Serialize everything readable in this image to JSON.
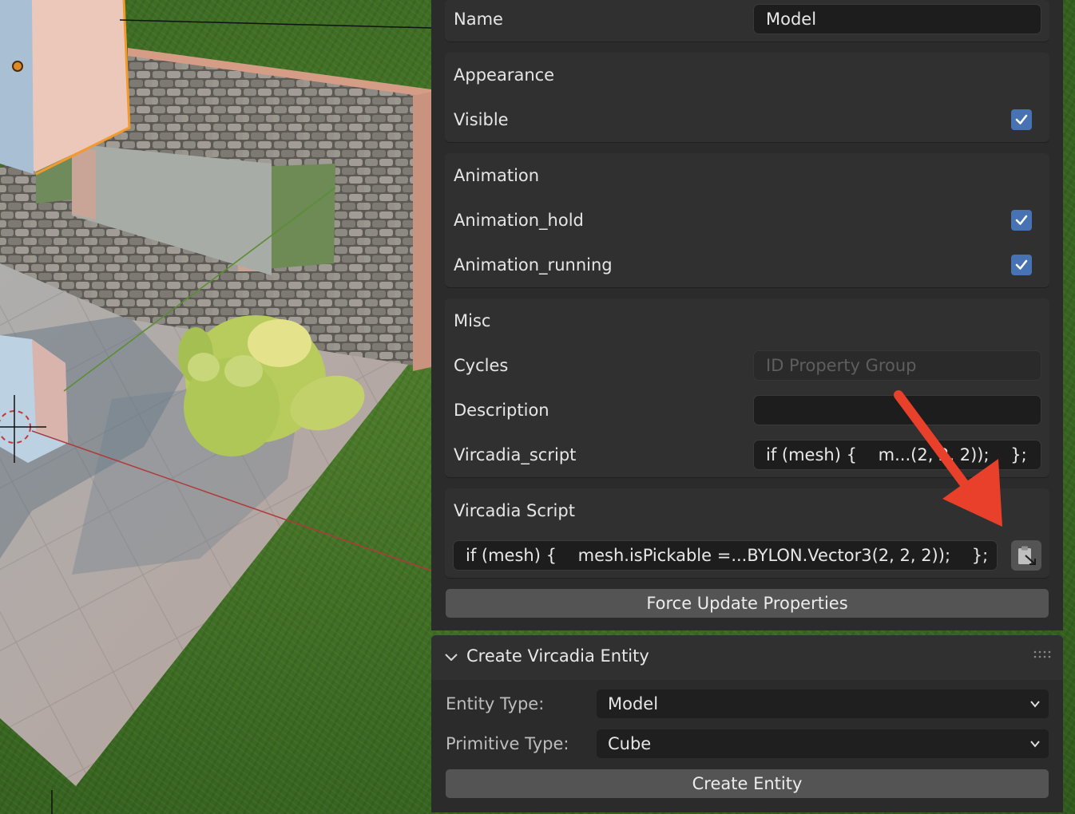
{
  "properties": {
    "name_label": "Name",
    "name_value": "Model",
    "appearance": {
      "header": "Appearance",
      "visible_label": "Visible",
      "visible_checked": true
    },
    "animation": {
      "header": "Animation",
      "hold_label": "Animation_hold",
      "hold_checked": true,
      "running_label": "Animation_running",
      "running_checked": true
    },
    "misc": {
      "header": "Misc",
      "cycles_label": "Cycles",
      "cycles_placeholder": "ID Property Group",
      "description_label": "Description",
      "description_value": "",
      "vircadia_script_label": "Vircadia_script",
      "vircadia_script_value": "if (mesh) {    m...(2, 2, 2));    };"
    },
    "vircadia_script_panel": {
      "header": "Vircadia Script",
      "script_value": "if (mesh) {    mesh.isPickable =...BYLON.Vector3(2, 2, 2));    };",
      "paste_icon": "clipboard-paste-icon"
    },
    "force_update_label": "Force Update Properties"
  },
  "create_panel": {
    "title": "Create Vircadia Entity",
    "entity_type_label": "Entity Type:",
    "entity_type_value": "Model",
    "primitive_type_label": "Primitive Type:",
    "primitive_type_value": "Cube",
    "create_button_label": "Create Entity"
  },
  "colors": {
    "accent_checkbox": "#4772b3",
    "annotation_arrow": "#e8402a",
    "panel_bg": "#2b2b2b"
  }
}
